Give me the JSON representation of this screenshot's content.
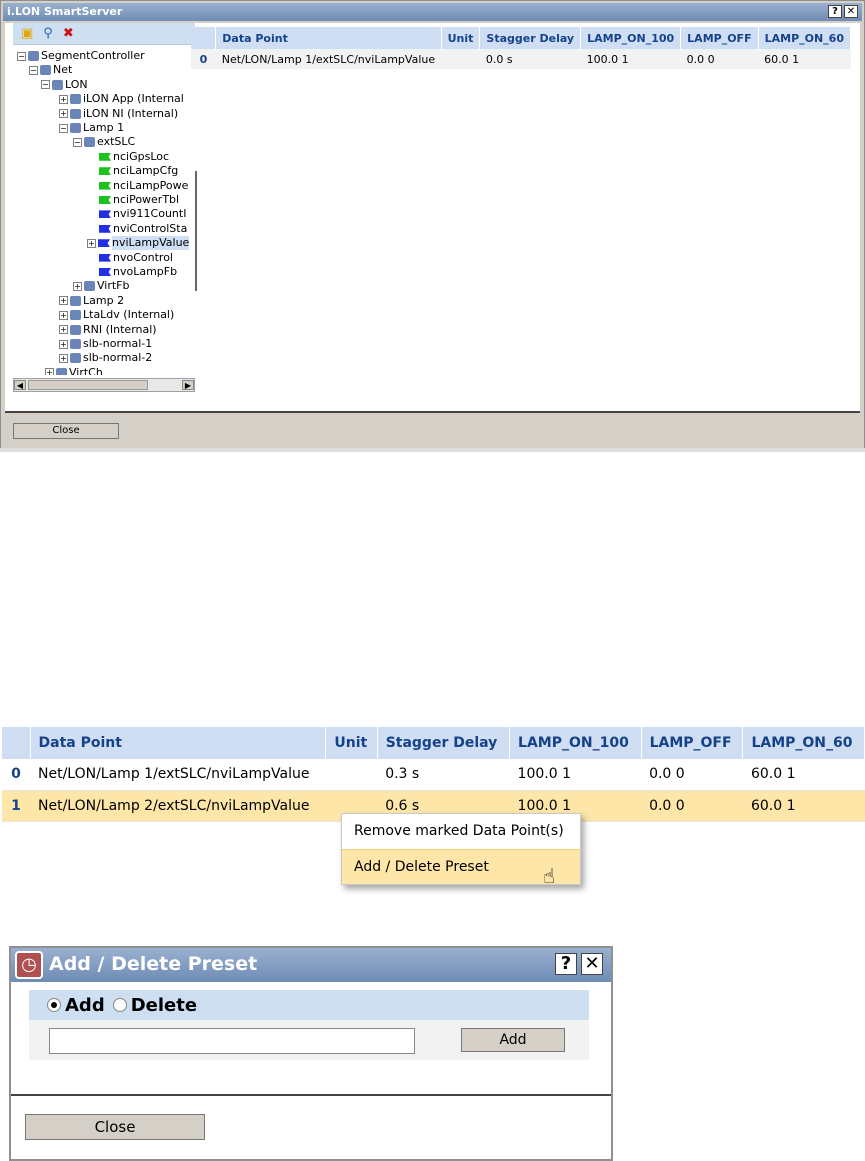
{
  "window1": {
    "title": "i.LON SmartServer",
    "help_btn": "?",
    "close_x": "✕",
    "toolbar_icons": [
      "toolbox-icon",
      "search-icon",
      "delete-icon"
    ],
    "tree": [
      {
        "label": "SegmentController",
        "exp": "-",
        "icon": "network-icon"
      },
      {
        "label": "Net",
        "exp": "-",
        "icon": "net-icon"
      },
      {
        "label": "LON",
        "exp": "-",
        "icon": "lon-icon"
      },
      {
        "label": "iLON App (Internal",
        "exp": "+",
        "icon": "app-icon"
      },
      {
        "label": "iLON NI (Internal)",
        "exp": "+",
        "icon": "ni-icon"
      },
      {
        "label": "Lamp 1",
        "exp": "-",
        "icon": "lamp-icon"
      },
      {
        "label": "extSLC",
        "exp": "-",
        "icon": "device-icon"
      },
      {
        "label": "nciGpsLoc",
        "exp": "",
        "icon": "green-flag-icon"
      },
      {
        "label": "nciLampCfg",
        "exp": "",
        "icon": "green-flag-icon"
      },
      {
        "label": "nciLampPowe",
        "exp": "",
        "icon": "green-flag-icon"
      },
      {
        "label": "nciPowerTbl",
        "exp": "",
        "icon": "green-flag-icon"
      },
      {
        "label": "nvi911CountI",
        "exp": "",
        "icon": "blue-flag-icon"
      },
      {
        "label": "nviControlSta",
        "exp": "",
        "icon": "blue-flag-icon"
      },
      {
        "label": "nviLampValue",
        "exp": "+",
        "icon": "blue-flag-icon"
      },
      {
        "label": "nvoControl",
        "exp": "",
        "icon": "blue-flag-icon"
      },
      {
        "label": "nvoLampFb",
        "exp": "",
        "icon": "blue-flag-icon"
      },
      {
        "label": "VirtFb",
        "exp": "+",
        "icon": "gear-icon"
      },
      {
        "label": "Lamp 2",
        "exp": "+",
        "icon": "lamp-icon"
      },
      {
        "label": "LtaLdv (Internal)",
        "exp": "+",
        "icon": "ldv-icon"
      },
      {
        "label": "RNI (Internal)",
        "exp": "+",
        "icon": "rni-icon"
      },
      {
        "label": "slb-normal-1",
        "exp": "+",
        "icon": "slb-icon"
      },
      {
        "label": "slb-normal-2",
        "exp": "+",
        "icon": "slb-icon"
      },
      {
        "label": "VirtCh",
        "exp": "+",
        "icon": "virtch-icon"
      }
    ],
    "grid": {
      "headers": [
        "",
        "Data Point",
        "Unit",
        "Stagger Delay",
        "LAMP_ON_100",
        "LAMP_OFF",
        "LAMP_ON_60"
      ],
      "rows": [
        [
          "0",
          "Net/LON/Lamp 1/extSLC/nviLampValue",
          "",
          "0.0 s",
          "100.0 1",
          "0.0 0",
          "60.0 1"
        ]
      ]
    },
    "close_label": "Close"
  },
  "grid2": {
    "headers": [
      "",
      "Data Point",
      "Unit",
      "Stagger Delay",
      "LAMP_ON_100",
      "LAMP_OFF",
      "LAMP_ON_60"
    ],
    "rows": [
      [
        "0",
        "Net/LON/Lamp 1/extSLC/nviLampValue",
        "",
        "0.3 s",
        "100.0 1",
        "0.0 0",
        "60.0 1"
      ],
      [
        "1",
        "Net/LON/Lamp 2/extSLC/nviLampValue",
        "",
        "0.6 s",
        "100.0 1",
        "0.0 0",
        "60.0 1"
      ]
    ]
  },
  "context_menu": {
    "items": [
      "Remove marked Data Point(s)",
      "Add / Delete Preset"
    ]
  },
  "window2": {
    "title": "Add / Delete Preset",
    "help_btn": "?",
    "close_x": "✕",
    "radio_add": "Add",
    "radio_delete": "Delete",
    "input_value": "",
    "add_label": "Add",
    "close_label": "Close"
  },
  "colors": {
    "titlebar": "#7f9bc4",
    "header_bg": "#cfdef2",
    "header_text": "#15428b",
    "highlight": "#fde6a8"
  }
}
